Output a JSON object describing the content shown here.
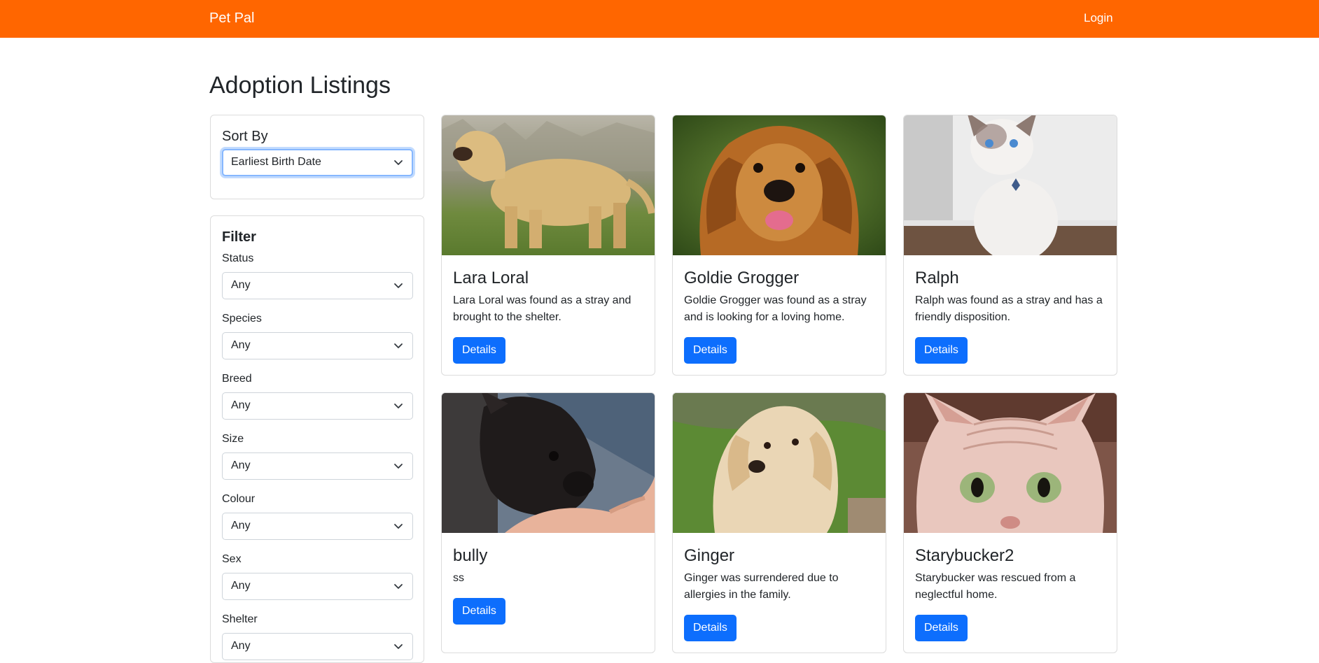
{
  "nav": {
    "brand": "Pet Pal",
    "login": "Login"
  },
  "page": {
    "title": "Adoption Listings"
  },
  "sort": {
    "heading": "Sort By",
    "selected": "Earliest Birth Date"
  },
  "filter": {
    "heading": "Filter",
    "fields": [
      {
        "label": "Status",
        "value": "Any"
      },
      {
        "label": "Species",
        "value": "Any"
      },
      {
        "label": "Breed",
        "value": "Any"
      },
      {
        "label": "Size",
        "value": "Any"
      },
      {
        "label": "Colour",
        "value": "Any"
      },
      {
        "label": "Sex",
        "value": "Any"
      },
      {
        "label": "Shelter",
        "value": "Any"
      }
    ]
  },
  "pets": [
    {
      "name": "Lara Loral",
      "description": "Lara Loral was found as a stray and brought to the shelter.",
      "button": "Details",
      "photo": "yellow-labrador-photo"
    },
    {
      "name": "Goldie Grogger",
      "description": "Goldie Grogger was found as a stray and is looking for a loving home.",
      "button": "Details",
      "photo": "golden-retriever-photo"
    },
    {
      "name": "Ralph",
      "description": "Ralph was found as a stray and has a friendly disposition.",
      "button": "Details",
      "photo": "white-kitten-photo"
    },
    {
      "name": "bully",
      "description": "ss",
      "button": "Details",
      "photo": "french-bulldog-puppy-photo"
    },
    {
      "name": "Ginger",
      "description": "Ginger was surrendered due to allergies in the family.",
      "button": "Details",
      "photo": "golden-dog-on-grass-photo"
    },
    {
      "name": "Starybucker2",
      "description": "Starybucker was rescued from a neglectful home.",
      "button": "Details",
      "photo": "sphynx-cat-photo"
    }
  ],
  "colors": {
    "navbar": "#ff6600",
    "button": "#0d6efd"
  },
  "icons": {
    "select_arrow": "chevron-down-icon"
  }
}
